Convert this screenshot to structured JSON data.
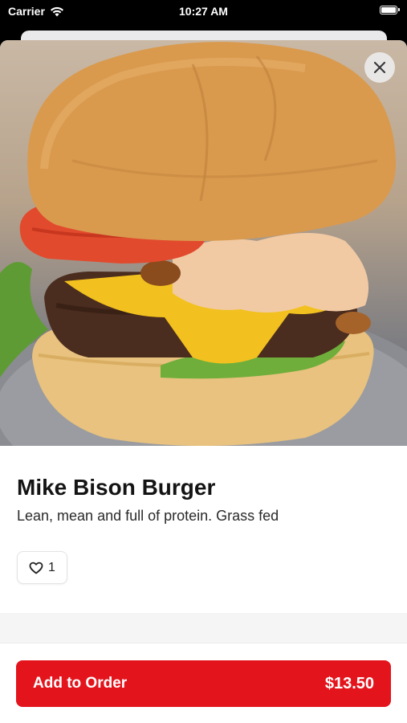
{
  "status_bar": {
    "carrier": "Carrier",
    "time": "10:27 AM",
    "icons": [
      "wifi-icon",
      "battery-icon"
    ]
  },
  "modal": {
    "close_icon": "close-icon"
  },
  "item": {
    "image_alt": "Burger photo",
    "title": "Mike Bison Burger",
    "description": "Lean, mean and full of protein. Grass fed",
    "likes": {
      "icon": "heart-icon",
      "count": "1"
    }
  },
  "footer": {
    "add_label": "Add to Order",
    "price": "$13.50",
    "accent_color": "#e3141c"
  }
}
